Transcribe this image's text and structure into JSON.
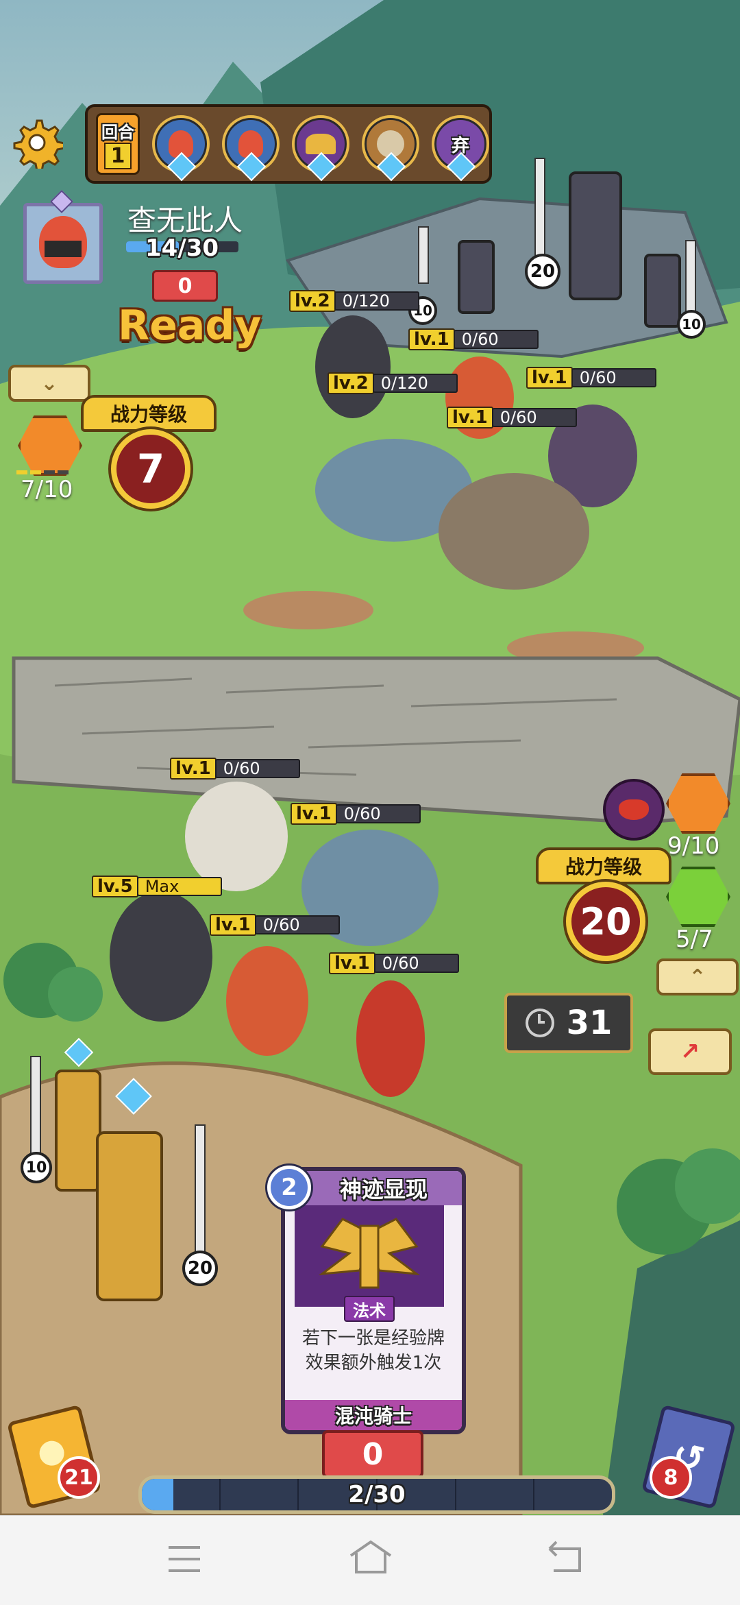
{
  "top_bar": {
    "round_label": "回合",
    "round_number": "1",
    "turn_order_icons": [
      "fire-warrior-icon",
      "fire-warrior-icon",
      "golden-wings-icon",
      "horned-beast-icon",
      "discard-mage-icon"
    ],
    "discard_badge": "弃"
  },
  "player": {
    "name": "查无此人",
    "hp": "14/30",
    "shield": "0",
    "status": "Ready",
    "power_label": "战力等级",
    "power_level": "7",
    "fire_count": "7/10"
  },
  "enemy_units": [
    {
      "level": "lv.2",
      "exp": "0/120"
    },
    {
      "level": "lv.1",
      "exp": "0/60"
    },
    {
      "level": "lv.2",
      "exp": "0/120"
    },
    {
      "level": "lv.1",
      "exp": "0/60"
    },
    {
      "level": "lv.1",
      "exp": "0/60"
    }
  ],
  "enemy_towers": [
    "20",
    "10",
    "10"
  ],
  "opponent": {
    "power_label": "战力等级",
    "power_level": "20",
    "fire_count": "9/10",
    "nature_count": "5/7"
  },
  "player_units": [
    {
      "level": "lv.1",
      "exp": "0/60"
    },
    {
      "level": "lv.1",
      "exp": "0/60"
    },
    {
      "level": "lv.5",
      "exp": "Max"
    },
    {
      "level": "lv.1",
      "exp": "0/60"
    },
    {
      "level": "lv.1",
      "exp": "0/60"
    }
  ],
  "player_towers": [
    "10",
    "20"
  ],
  "timer": "31",
  "card": {
    "cost": "2",
    "name": "神迹显现",
    "type": "法术",
    "description_line1": "若下一张是经验牌",
    "description_line2": "效果额外触发1次",
    "faction": "混沌骑士"
  },
  "bottom": {
    "deck_count": "21",
    "discard_count": "8",
    "energy": "0",
    "progress_text": "2/30",
    "progress_fraction": 0.067
  },
  "colors": {
    "accent_gold": "#f1cf2e",
    "hp_blue": "#5aa9f0",
    "card_purple": "#6b3a8f"
  }
}
